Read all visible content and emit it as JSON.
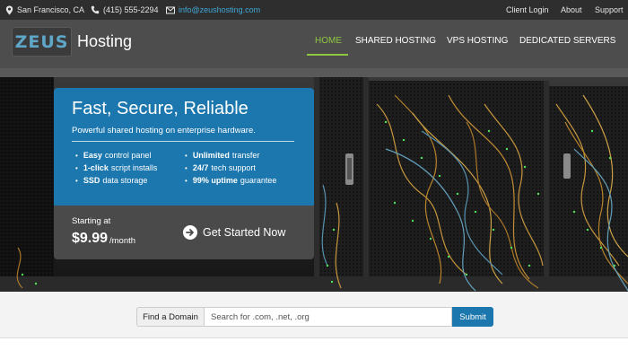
{
  "topbar": {
    "location": "San Francisco, CA",
    "phone": "(415) 555-2294",
    "email": "info@zeushosting.com",
    "links": [
      "Client Login",
      "About",
      "Support"
    ]
  },
  "header": {
    "logo_text": "ZEUS",
    "brand": "Hosting",
    "nav": [
      "HOME",
      "SHARED HOSTING",
      "VPS HOSTING",
      "DEDICATED SERVERS"
    ],
    "active_nav": "HOME"
  },
  "hero": {
    "title": "Fast, Secure, Reliable",
    "subtitle": "Powerful shared hosting on enterprise hardware.",
    "features": [
      {
        "bold": "Easy",
        "rest": " control panel"
      },
      {
        "bold": "1-click",
        "rest": " script installs"
      },
      {
        "bold": "SSD",
        "rest": " data storage"
      },
      {
        "bold": "Unlimited",
        "rest": " transfer"
      },
      {
        "bold": "24/7",
        "rest": " tech support"
      },
      {
        "bold": "99% uptime",
        "rest": " guarantee"
      }
    ],
    "starting_label": "Starting at",
    "price": "$9.99",
    "per": "/month",
    "cta": "Get Started Now"
  },
  "search": {
    "label": "Find a Domain",
    "placeholder": "Search for .com, .net, .org",
    "submit": "Submit"
  },
  "colors": {
    "accent_green": "#8ec63f",
    "brand_blue": "#1b77ad",
    "link_blue": "#3fa7d6"
  },
  "icons": [
    "map-marker-icon",
    "phone-icon",
    "envelope-icon",
    "arrow-circle-right-icon"
  ]
}
